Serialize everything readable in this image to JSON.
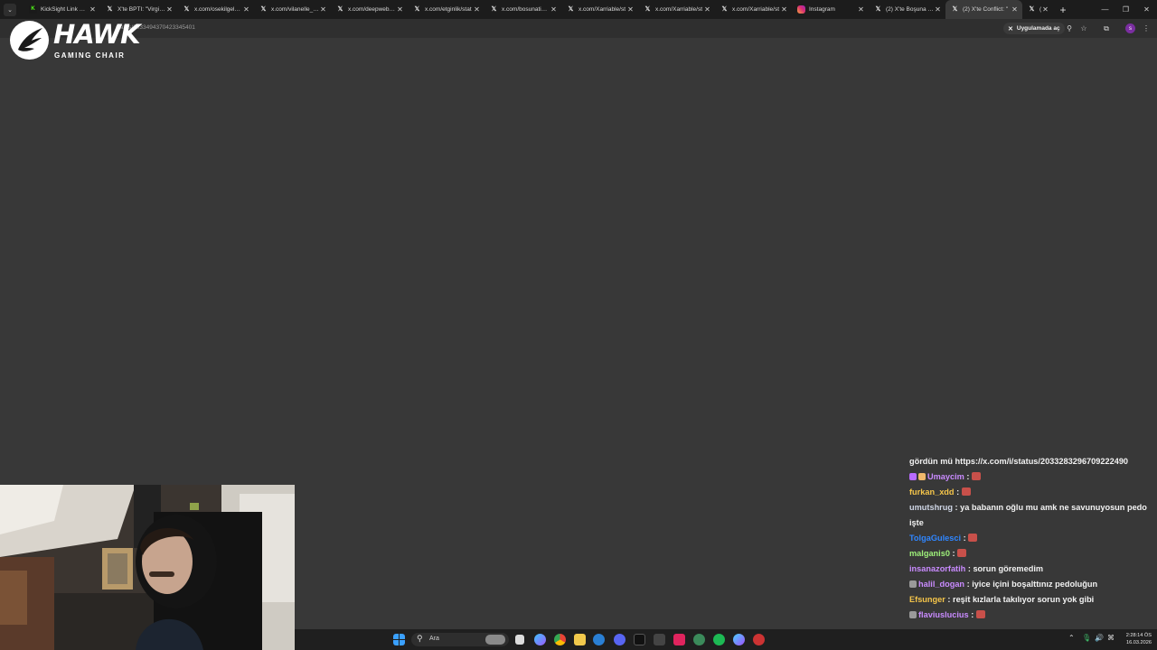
{
  "tabs": [
    {
      "title": "KickSight Link Dete",
      "icon": "kick-icon",
      "active": false
    },
    {
      "title": "X'te BPTI: \"Virginia",
      "icon": "x-icon",
      "active": false
    },
    {
      "title": "x.com/osekilgelamıs",
      "icon": "x-icon",
      "active": false
    },
    {
      "title": "x.com/vilanelle_/st",
      "icon": "x-icon",
      "active": false
    },
    {
      "title": "x.com/deepwebcet",
      "icon": "x-icon",
      "active": false
    },
    {
      "title": "x.com/etginlik/stat",
      "icon": "x-icon",
      "active": false
    },
    {
      "title": "x.com/bosunatiklar",
      "icon": "x-icon",
      "active": false
    },
    {
      "title": "x.com/Xarriable/st",
      "icon": "x-icon",
      "active": false
    },
    {
      "title": "x.com/Xarriable/st",
      "icon": "x-icon",
      "active": false
    },
    {
      "title": "x.com/Xarriable/st",
      "icon": "x-icon",
      "active": false
    },
    {
      "title": "Instagram",
      "icon": "instagram-icon",
      "active": false
    },
    {
      "title": "(2) X'te Boşuna Tık",
      "icon": "x-icon",
      "active": false
    },
    {
      "title": "(2) X'te Conflict: \"",
      "icon": "x-icon",
      "active": true
    },
    {
      "title": "(2)",
      "icon": "x-icon",
      "active": false
    }
  ],
  "address_bar": {
    "url": "status/2033494370423345401",
    "open_in_app_label": "Uygulamada aç"
  },
  "overlay": {
    "brand_name": "HAWK",
    "brand_subtitle": "GAMING CHAIR"
  },
  "chat": {
    "messages": [
      {
        "user": "",
        "text": "gördün mü https://x.com/i/status/2033283296709222490",
        "color": "#f2f2f2",
        "badges": [],
        "emote": false
      },
      {
        "user": "Umaycim",
        "text": " : ",
        "color": "#c98bff",
        "badges": [
          "#b96bff",
          "#f0b86b"
        ],
        "emote": true
      },
      {
        "user": "furkan_xdd",
        "text": " : ",
        "color": "#f5c54a",
        "badges": [],
        "emote": true
      },
      {
        "user": "umutshrug",
        "text": " : ya babanın oğlu mu amk ne savunuyosun pedo işte",
        "color": "#cfd6e6",
        "badges": [],
        "emote": false
      },
      {
        "user": "TolgaGulesci",
        "text": " : ",
        "color": "#2f86ff",
        "badges": [],
        "emote": true
      },
      {
        "user": "malganis0",
        "text": " : ",
        "color": "#9ef07a",
        "badges": [],
        "emote": true
      },
      {
        "user": "insanazorfatih",
        "text": " : sorun göremedim",
        "color": "#c98bff",
        "badges": [],
        "emote": false
      },
      {
        "user": "halil_dogan",
        "text": " : iyice içini boşalttınız pedoluğun",
        "color": "#c98bff",
        "badges": [
          "#9a9a9a"
        ],
        "emote": false
      },
      {
        "user": "Efsunger",
        "text": " : reşit kızlarla takılıyor sorun yok gibi",
        "color": "#f5c54a",
        "badges": [],
        "emote": false
      },
      {
        "user": "flaviuslucius",
        "text": " : ",
        "color": "#c98bff",
        "badges": [
          "#9a9a9a"
        ],
        "emote": true
      }
    ]
  },
  "taskbar": {
    "search_placeholder": "Ara",
    "time": "2:28:14 ÖS",
    "date": "16.03.2026"
  }
}
